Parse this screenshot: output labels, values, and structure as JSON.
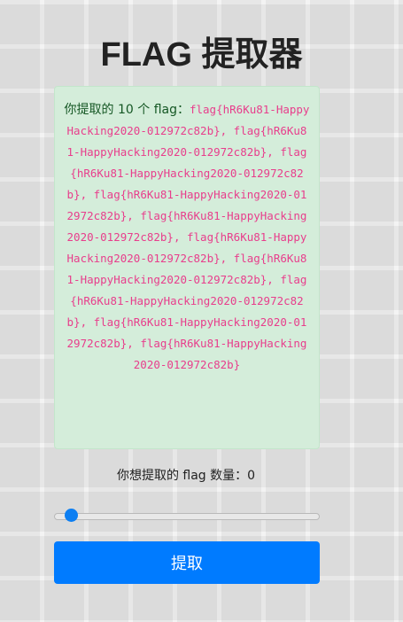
{
  "page": {
    "title": "FLAG 提取器"
  },
  "result": {
    "prefix": "你提取的 10 个 flag：",
    "flags": "flag{hR6Ku81-HappyHacking2020-012972c82b}, flag{hR6Ku81-HappyHacking2020-012972c82b}, flag{hR6Ku81-HappyHacking2020-012972c82b}, flag{hR6Ku81-HappyHacking2020-012972c82b}, flag{hR6Ku81-HappyHacking2020-012972c82b}, flag{hR6Ku81-HappyHacking2020-012972c82b}, flag{hR6Ku81-HappyHacking2020-012972c82b}, flag{hR6Ku81-HappyHacking2020-012972c82b}, flag{hR6Ku81-HappyHacking2020-012972c82b}, flag{hR6Ku81-HappyHacking2020-012972c82b}"
  },
  "form": {
    "count_label": "你想提取的 flag 数量：0",
    "slider_value": 0,
    "submit_label": "提取"
  },
  "colors": {
    "accent": "#007bff",
    "flag_text": "#e83e8c",
    "alert_bg": "#d4edda",
    "alert_text": "#155724"
  }
}
